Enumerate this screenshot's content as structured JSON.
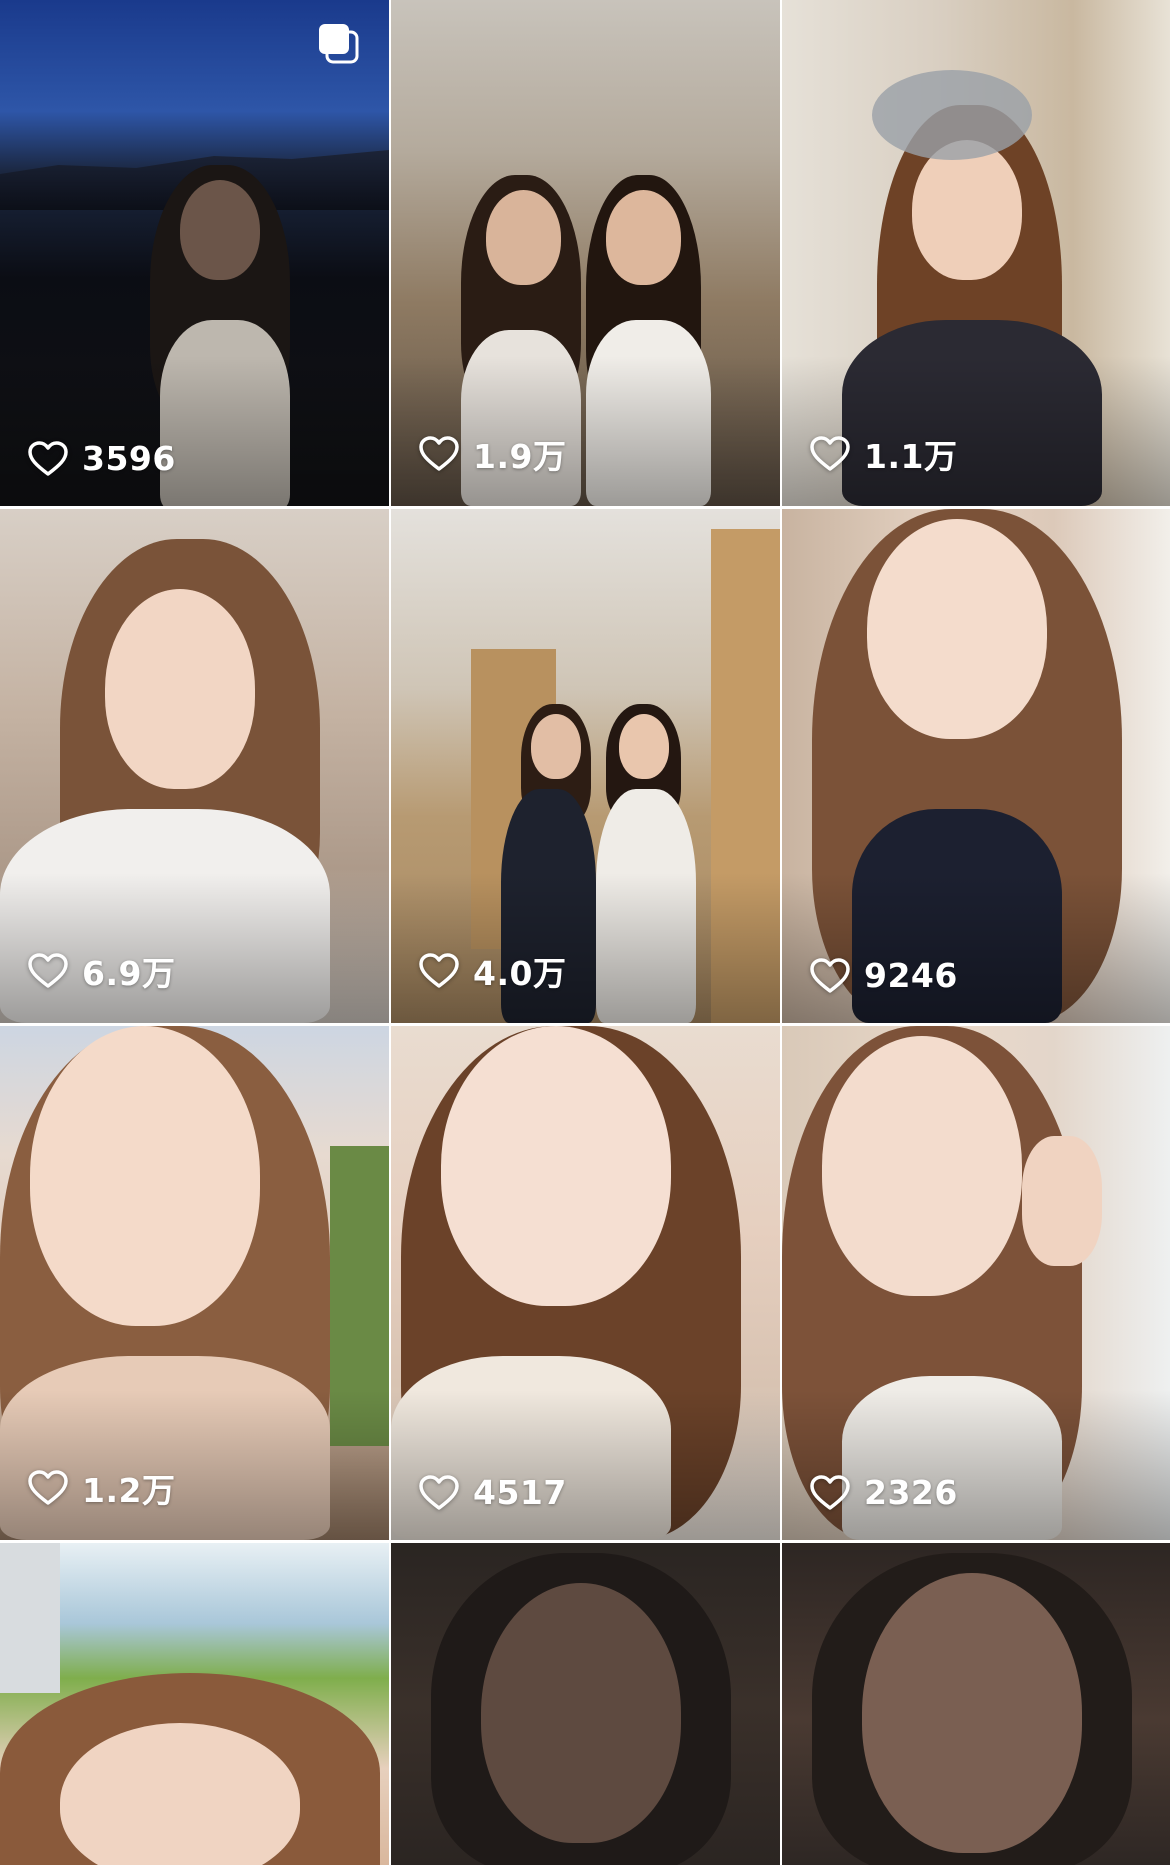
{
  "grid": {
    "tiles": [
      {
        "likes": "3596",
        "multi_photo": true
      },
      {
        "likes": "1.9万"
      },
      {
        "likes": "1.1万"
      },
      {
        "likes": "6.9万"
      },
      {
        "likes": "4.0万"
      },
      {
        "likes": "9246"
      },
      {
        "likes": "1.2万"
      },
      {
        "likes": "4517"
      },
      {
        "likes": "2326"
      },
      {
        "likes": null
      },
      {
        "likes": null
      },
      {
        "likes": null
      }
    ]
  },
  "icons": {
    "like": "heart-outline-icon",
    "multi": "multiple-photos-icon"
  },
  "colors": {
    "overlay_text": "#ffffff",
    "background": "#ffffff"
  }
}
